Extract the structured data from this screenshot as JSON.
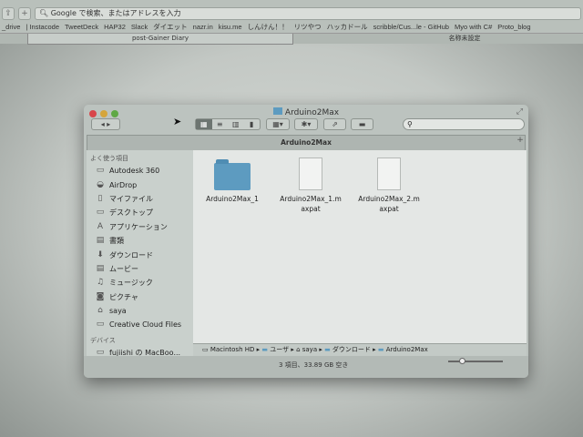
{
  "browser": {
    "address_placeholder": "Google で検索、またはアドレスを入力",
    "bookmarks": [
      "_drive",
      "| Instacode",
      "TweetDeck",
      "HAP32",
      "Slack",
      "ダイエット",
      "nazr.in",
      "kisu.me",
      "しんけん！！",
      "リツやつ",
      "ハッカドール",
      "scribble/Cus...le - GitHub",
      "Myo with C#",
      "Proto_blog"
    ],
    "tabs": [
      "post-Gainer Diary",
      "名称未設定"
    ]
  },
  "finder": {
    "title": "Arduino2Max",
    "tab_label": "Arduino2Max",
    "sidebar": {
      "favorites_header": "よく使う項目",
      "favorites": [
        {
          "label": "Autodesk 360",
          "icon": "folder-icon"
        },
        {
          "label": "AirDrop",
          "icon": "airdrop-icon"
        },
        {
          "label": "マイファイル",
          "icon": "all-files-icon"
        },
        {
          "label": "デスクトップ",
          "icon": "desktop-icon"
        },
        {
          "label": "アプリケーション",
          "icon": "applications-icon"
        },
        {
          "label": "書類",
          "icon": "documents-icon"
        },
        {
          "label": "ダウンロード",
          "icon": "download-icon"
        },
        {
          "label": "ムービー",
          "icon": "movies-icon"
        },
        {
          "label": "ミュージック",
          "icon": "music-icon"
        },
        {
          "label": "ピクチャ",
          "icon": "camera-icon"
        },
        {
          "label": "saya",
          "icon": "home-icon"
        },
        {
          "label": "Creative Cloud Files",
          "icon": "folder-icon"
        }
      ],
      "devices_header": "デバイス",
      "devices": [
        {
          "label": "fujiishi の MacBoo...",
          "icon": "laptop-icon"
        }
      ]
    },
    "files": [
      {
        "name": "Arduino2Max_1",
        "type": "folder"
      },
      {
        "name": "Arduino2Max_1.maxpat",
        "type": "document"
      },
      {
        "name": "Arduino2Max_2.maxpat",
        "type": "document"
      }
    ],
    "path": [
      "Macintosh HD",
      "ユーザ",
      "saya",
      "ダウンロード",
      "Arduino2Max"
    ],
    "status": "3 項目、33.89 GB 空き",
    "icon_size": 0.2
  }
}
